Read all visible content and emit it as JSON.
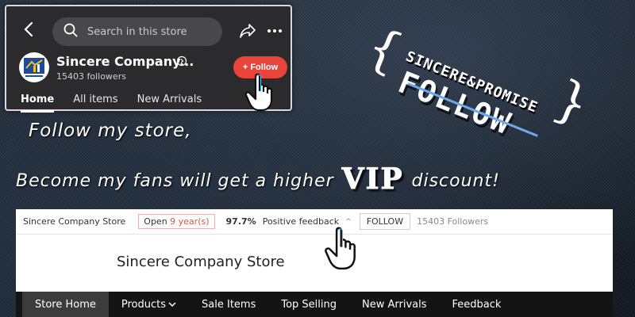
{
  "mobile": {
    "search_placeholder": "Search in this store",
    "store_name": "Sincere Company...",
    "followers": "15403 followers",
    "follow_button": "+ Follow",
    "tabs": [
      {
        "label": "Home",
        "active": true
      },
      {
        "label": "All items",
        "active": false
      },
      {
        "label": "New Arrivals",
        "active": false
      }
    ]
  },
  "promo": {
    "line1": "Follow my store,",
    "line2_before": "Become my fans will get a higher",
    "vip": "VIP",
    "line2_after": "discount!"
  },
  "badge": {
    "subtitle": "SINCERE&PROMISE",
    "title": "FOLLOW"
  },
  "desktop": {
    "store_name_small": "Sincere Company Store",
    "open_prefix": "Open",
    "open_years": "9 year(s)",
    "positive_percent": "97.7%",
    "positive_label": "Positive feedback",
    "follow_button": "FOLLOW",
    "followers": "15403 Followers",
    "store_title": "Sincere Company Store",
    "nav": [
      {
        "label": "Store Home",
        "active": true
      },
      {
        "label": "Products",
        "active": false,
        "dropdown": true
      },
      {
        "label": "Sale Items",
        "active": false
      },
      {
        "label": "Top Selling",
        "active": false
      },
      {
        "label": "New Arrivals",
        "active": false
      },
      {
        "label": "Feedback",
        "active": false
      }
    ]
  },
  "colors": {
    "follow_red": "#e8443a",
    "accent_blue": "#6fa8e8",
    "nav_bg": "#141414"
  },
  "icons": [
    "back-icon",
    "search-icon",
    "share-icon",
    "more-icon",
    "info-icon",
    "pointing-hand-icon",
    "caret-up-icon",
    "chevron-down-icon"
  ]
}
